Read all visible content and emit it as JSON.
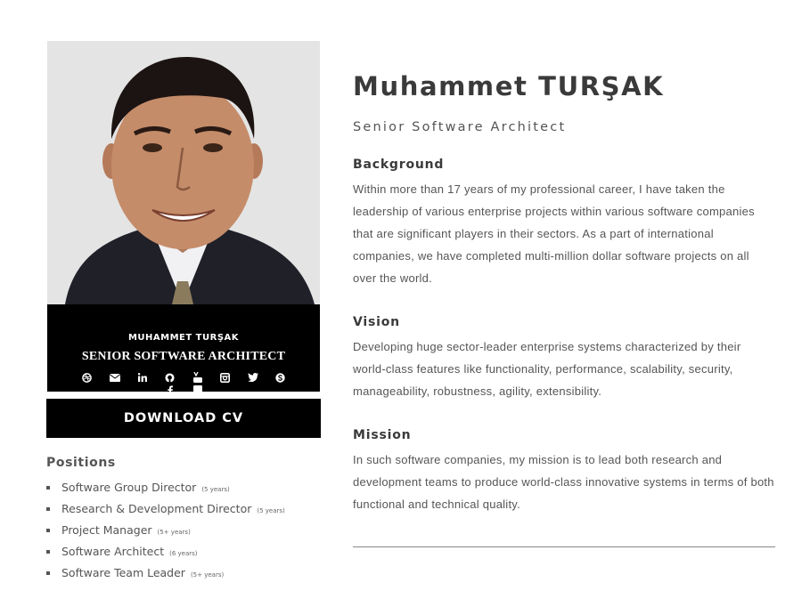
{
  "profile": {
    "card_name": "MUHAMMET TURŞAK",
    "card_title": "SENIOR SOFTWARE ARCHITECT",
    "download_label": "DOWNLOAD CV",
    "socials": [
      "dribbble-icon",
      "email-icon",
      "linkedin-icon",
      "github-icon",
      "youtube-icon",
      "instagram-icon",
      "twitter-icon",
      "skype-icon",
      "facebook-icon",
      "flickr-icon"
    ]
  },
  "positions": {
    "heading": "Positions",
    "items": [
      {
        "title": "Software Group Director",
        "years": "(5 years)"
      },
      {
        "title": "Research & Development Director",
        "years": "(5 years)"
      },
      {
        "title": "Project Manager",
        "years": "(5+ years)"
      },
      {
        "title": "Software Architect",
        "years": "(6 years)"
      },
      {
        "title": "Software Team Leader",
        "years": "(5+ years)"
      }
    ]
  },
  "main": {
    "name": "Muhammet TURŞAK",
    "subtitle": "Senior Software Architect",
    "background": {
      "title": "Background",
      "text": "Within more than 17 years of my professional career, I have taken the leadership of various enterprise projects within various software companies that are significant players in their sectors. As a part of international companies, we have completed multi-million dollar software projects on all over the world."
    },
    "vision": {
      "title": "Vision",
      "text": "Developing huge sector-leader enterprise systems characterized by their world-class features like functionality, performance, scalability, security, manageability, robustness, agility, extensibility."
    },
    "mission": {
      "title": "Mission",
      "text": "In such software companies, my mission is to lead both research and development teams to produce world-class innovative systems in terms of both functional and technical quality."
    }
  }
}
